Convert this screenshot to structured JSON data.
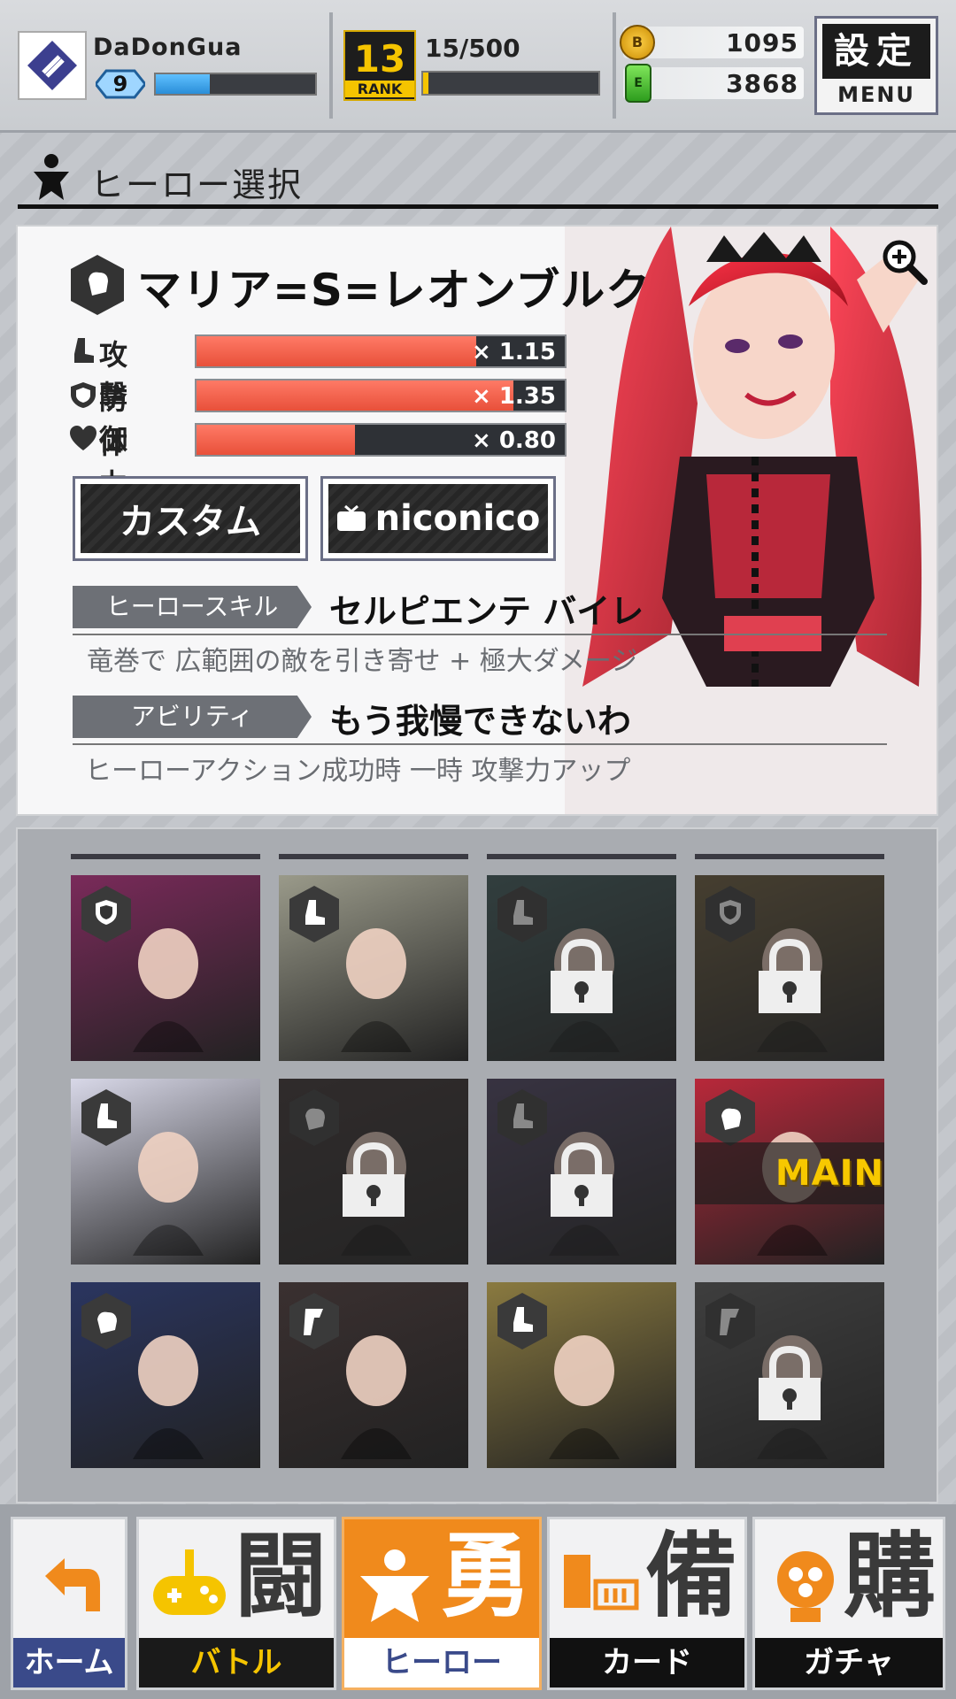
{
  "header": {
    "username": "DaDonGua",
    "level": "9",
    "xp_fraction": 0.34,
    "rank": "13",
    "rank_label": "RANK",
    "rank_progress": "15/500",
    "rank_fraction": 0.03,
    "gold": "1095",
    "gold_icon_label": "B",
    "gems": "3868",
    "gem_icon_label": "E",
    "menu_jp": "設定",
    "menu_en": "MENU"
  },
  "section": {
    "title": "ヒーロー選択",
    "icon": "hero-icon"
  },
  "hero": {
    "name": "マリア=S=レオンブルク",
    "type_icon": "fist-icon",
    "stats": [
      {
        "label": "攻撃",
        "value": "× 1.15",
        "fraction": 0.76,
        "icon": "boot-icon"
      },
      {
        "label": "防御",
        "value": "× 1.35",
        "fraction": 0.86,
        "icon": "shield-icon"
      },
      {
        "label": "体力",
        "value": "× 0.80",
        "fraction": 0.43,
        "icon": "heart-icon"
      }
    ],
    "custom_button": "カスタム",
    "niconico_button": "niconico",
    "skill_tag": "ヒーロースキル",
    "skill_name": "セルピエンテ バイレ",
    "skill_desc": "竜巻で 広範囲の敵を引き寄せ + 極大ダメージ",
    "ability_tag": "アビリティ",
    "ability_name": "もう我慢できないわ",
    "ability_desc": "ヒーローアクション成功時 一時 攻撃力アップ"
  },
  "grid": {
    "main_label": "MAIN",
    "tiles": [
      {
        "badge": "shield",
        "locked": false,
        "color": "#7a2a5a"
      },
      {
        "badge": "boot",
        "locked": false,
        "color": "#9a9a8a"
      },
      {
        "badge": "boot",
        "locked": true,
        "color": "#3d5a5a"
      },
      {
        "badge": "shield",
        "locked": true,
        "color": "#6a5a3a"
      },
      {
        "badge": "boot",
        "locked": false,
        "color": "#d8d8e8"
      },
      {
        "badge": "fist",
        "locked": true,
        "color": "#3a3030"
      },
      {
        "badge": "boot",
        "locked": true,
        "color": "#4a4060"
      },
      {
        "badge": "fist",
        "locked": false,
        "color": "#b8283a",
        "main": true
      },
      {
        "badge": "fist",
        "locked": false,
        "color": "#2a3560"
      },
      {
        "badge": "p",
        "locked": false,
        "color": "#3a3030"
      },
      {
        "badge": "boot",
        "locked": false,
        "color": "#8a7a40"
      },
      {
        "badge": "p",
        "locked": true,
        "color": "#5a5a5a"
      }
    ]
  },
  "nav": [
    {
      "label": "ホーム",
      "big": "",
      "accent": "#f08a1c",
      "label_bg": "#3a4a8a",
      "label_color": "#ffffff"
    },
    {
      "label": "バトル",
      "big": "闘",
      "accent": "#f5c400",
      "label_bg": "#1a1a1a",
      "label_color": "#f5c400"
    },
    {
      "label": "ヒーロー",
      "big": "勇",
      "accent": "#f08a1c",
      "label_bg": "#ffffff",
      "label_color": "#3a4a8a"
    },
    {
      "label": "カード",
      "big": "備",
      "accent": "#f08a1c",
      "label_bg": "#111111",
      "label_color": "#ffffff"
    },
    {
      "label": "ガチャ",
      "big": "購",
      "accent": "#f08a1c",
      "label_bg": "#111111",
      "label_color": "#ffffff"
    }
  ]
}
